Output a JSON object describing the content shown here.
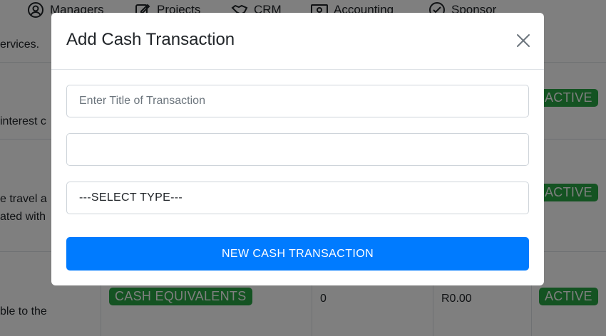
{
  "nav": {
    "items": [
      {
        "label": "Managers",
        "icon": "user-circle-icon"
      },
      {
        "label": "Projects",
        "icon": "edit-icon"
      },
      {
        "label": "CRM",
        "icon": "handshake-icon"
      },
      {
        "label": "Accounting",
        "icon": "money-bill-icon"
      },
      {
        "label": "Sponsor",
        "icon": "check-circle-icon"
      }
    ]
  },
  "background": {
    "intro_text": "ervices.",
    "rows": [
      {
        "text_lines": [
          "interest c"
        ],
        "status": "ACTIVE"
      },
      {
        "text_lines": [
          "e travel a",
          "ated with"
        ],
        "status": "ACTIVE"
      },
      {
        "text_lines": [
          "ble to the"
        ],
        "type_badge": "CASH EQUIVALENTS",
        "count": "0",
        "amount": "R0.00",
        "status": "ACTIVE"
      }
    ]
  },
  "modal": {
    "title": "Add Cash Transaction",
    "title_placeholder": "Enter Title of Transaction",
    "amount_value": "",
    "type_select": "---SELECT TYPE---",
    "submit_label": "NEW CASH TRANSACTION"
  },
  "colors": {
    "primary": "#007bff",
    "success": "#28a745",
    "overlay": "rgba(0,0,0,0.5)"
  }
}
